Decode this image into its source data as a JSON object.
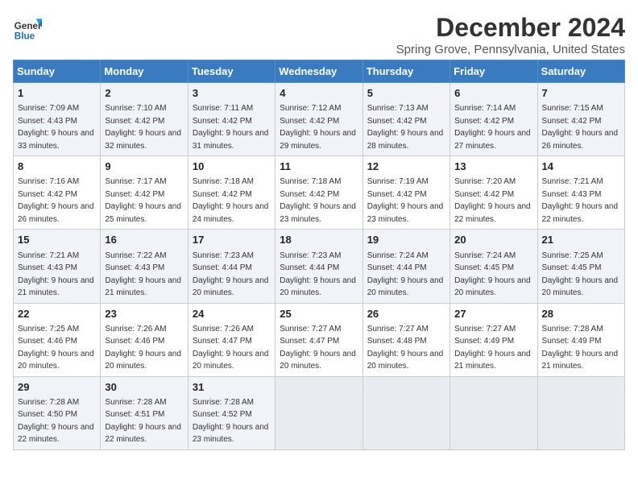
{
  "logo": {
    "line1": "General",
    "line2": "Blue"
  },
  "title": "December 2024",
  "location": "Spring Grove, Pennsylvania, United States",
  "weekdays": [
    "Sunday",
    "Monday",
    "Tuesday",
    "Wednesday",
    "Thursday",
    "Friday",
    "Saturday"
  ],
  "weeks": [
    [
      {
        "day": "1",
        "sunrise": "7:09 AM",
        "sunset": "4:43 PM",
        "daylight": "9 hours and 33 minutes."
      },
      {
        "day": "2",
        "sunrise": "7:10 AM",
        "sunset": "4:42 PM",
        "daylight": "9 hours and 32 minutes."
      },
      {
        "day": "3",
        "sunrise": "7:11 AM",
        "sunset": "4:42 PM",
        "daylight": "9 hours and 31 minutes."
      },
      {
        "day": "4",
        "sunrise": "7:12 AM",
        "sunset": "4:42 PM",
        "daylight": "9 hours and 29 minutes."
      },
      {
        "day": "5",
        "sunrise": "7:13 AM",
        "sunset": "4:42 PM",
        "daylight": "9 hours and 28 minutes."
      },
      {
        "day": "6",
        "sunrise": "7:14 AM",
        "sunset": "4:42 PM",
        "daylight": "9 hours and 27 minutes."
      },
      {
        "day": "7",
        "sunrise": "7:15 AM",
        "sunset": "4:42 PM",
        "daylight": "9 hours and 26 minutes."
      }
    ],
    [
      {
        "day": "8",
        "sunrise": "7:16 AM",
        "sunset": "4:42 PM",
        "daylight": "9 hours and 26 minutes."
      },
      {
        "day": "9",
        "sunrise": "7:17 AM",
        "sunset": "4:42 PM",
        "daylight": "9 hours and 25 minutes."
      },
      {
        "day": "10",
        "sunrise": "7:18 AM",
        "sunset": "4:42 PM",
        "daylight": "9 hours and 24 minutes."
      },
      {
        "day": "11",
        "sunrise": "7:18 AM",
        "sunset": "4:42 PM",
        "daylight": "9 hours and 23 minutes."
      },
      {
        "day": "12",
        "sunrise": "7:19 AM",
        "sunset": "4:42 PM",
        "daylight": "9 hours and 23 minutes."
      },
      {
        "day": "13",
        "sunrise": "7:20 AM",
        "sunset": "4:42 PM",
        "daylight": "9 hours and 22 minutes."
      },
      {
        "day": "14",
        "sunrise": "7:21 AM",
        "sunset": "4:43 PM",
        "daylight": "9 hours and 22 minutes."
      }
    ],
    [
      {
        "day": "15",
        "sunrise": "7:21 AM",
        "sunset": "4:43 PM",
        "daylight": "9 hours and 21 minutes."
      },
      {
        "day": "16",
        "sunrise": "7:22 AM",
        "sunset": "4:43 PM",
        "daylight": "9 hours and 21 minutes."
      },
      {
        "day": "17",
        "sunrise": "7:23 AM",
        "sunset": "4:44 PM",
        "daylight": "9 hours and 20 minutes."
      },
      {
        "day": "18",
        "sunrise": "7:23 AM",
        "sunset": "4:44 PM",
        "daylight": "9 hours and 20 minutes."
      },
      {
        "day": "19",
        "sunrise": "7:24 AM",
        "sunset": "4:44 PM",
        "daylight": "9 hours and 20 minutes."
      },
      {
        "day": "20",
        "sunrise": "7:24 AM",
        "sunset": "4:45 PM",
        "daylight": "9 hours and 20 minutes."
      },
      {
        "day": "21",
        "sunrise": "7:25 AM",
        "sunset": "4:45 PM",
        "daylight": "9 hours and 20 minutes."
      }
    ],
    [
      {
        "day": "22",
        "sunrise": "7:25 AM",
        "sunset": "4:46 PM",
        "daylight": "9 hours and 20 minutes."
      },
      {
        "day": "23",
        "sunrise": "7:26 AM",
        "sunset": "4:46 PM",
        "daylight": "9 hours and 20 minutes."
      },
      {
        "day": "24",
        "sunrise": "7:26 AM",
        "sunset": "4:47 PM",
        "daylight": "9 hours and 20 minutes."
      },
      {
        "day": "25",
        "sunrise": "7:27 AM",
        "sunset": "4:47 PM",
        "daylight": "9 hours and 20 minutes."
      },
      {
        "day": "26",
        "sunrise": "7:27 AM",
        "sunset": "4:48 PM",
        "daylight": "9 hours and 20 minutes."
      },
      {
        "day": "27",
        "sunrise": "7:27 AM",
        "sunset": "4:49 PM",
        "daylight": "9 hours and 21 minutes."
      },
      {
        "day": "28",
        "sunrise": "7:28 AM",
        "sunset": "4:49 PM",
        "daylight": "9 hours and 21 minutes."
      }
    ],
    [
      {
        "day": "29",
        "sunrise": "7:28 AM",
        "sunset": "4:50 PM",
        "daylight": "9 hours and 22 minutes."
      },
      {
        "day": "30",
        "sunrise": "7:28 AM",
        "sunset": "4:51 PM",
        "daylight": "9 hours and 22 minutes."
      },
      {
        "day": "31",
        "sunrise": "7:28 AM",
        "sunset": "4:52 PM",
        "daylight": "9 hours and 23 minutes."
      },
      null,
      null,
      null,
      null
    ]
  ]
}
